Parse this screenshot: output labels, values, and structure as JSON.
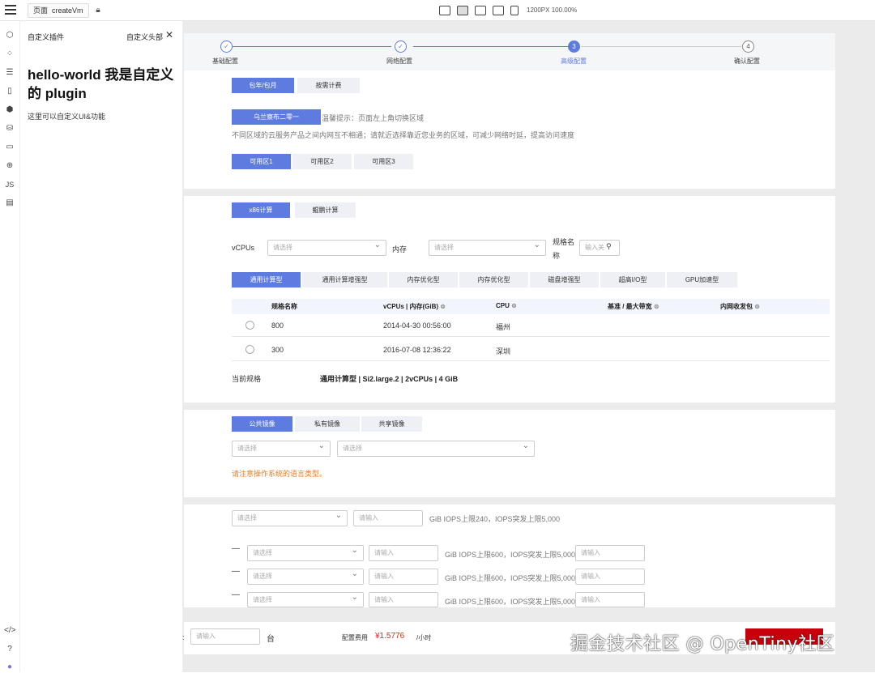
{
  "topbar": {
    "page_label": "页面",
    "page_name": "createVm",
    "zoom": "1200PX 100.00%"
  },
  "plugin": {
    "title": "自定义插件",
    "header_link": "自定义头部",
    "close": "✕",
    "hello": "hello-world 我是自定义的 plugin",
    "desc": "这里可以自定义UI&功能"
  },
  "steps": [
    {
      "num": "✓",
      "label": "基础配置"
    },
    {
      "num": "✓",
      "label": "网络配置"
    },
    {
      "num": "3",
      "label": "高级配置"
    },
    {
      "num": "4",
      "label": "确认配置"
    }
  ],
  "billing": {
    "monthly": "包年/包月",
    "on_demand": "按需计费"
  },
  "region": {
    "button": "乌兰察布二零一",
    "tip": "温馨提示：页面左上角切换区域",
    "note": "不同区域的云服务产品之间内网互不相通；请就近选择靠近您业务的区域，可减少网络时延，提高访问速度"
  },
  "zones": [
    "可用区1",
    "可用区2",
    "可用区3"
  ],
  "arch": [
    "x86计算",
    "鲲鹏计算"
  ],
  "filters": {
    "vcpus_label": "vCPUs",
    "vcpus_placeholder": "请选择",
    "mem_label": "内存",
    "mem_placeholder": "请选择",
    "spec_label": "规格名称",
    "spec_placeholder": "输入关"
  },
  "types": [
    "通用计算型",
    "通用计算增强型",
    "内存优化型",
    "内存优化型",
    "磁盘增强型",
    "超高I/O型",
    "GPU加速型"
  ],
  "table": {
    "headers": [
      "规格名称",
      "vCPUs | 内存(GiB)",
      "CPU",
      "基准 / 最大带宽",
      "内网收发包"
    ],
    "rows": [
      {
        "name": "800",
        "date": "2014-04-30 00:56:00",
        "city": "福州"
      },
      {
        "name": "300",
        "date": "2016-07-08 12:36:22",
        "city": "深圳"
      }
    ]
  },
  "current_spec": {
    "label": "当前规格",
    "value": "通用计算型 | Si2.large.2 | 2vCPUs | 4 GiB"
  },
  "images": {
    "tabs": [
      "公共镜像",
      "私有镜像",
      "共享镜像"
    ],
    "sel1": "请选择",
    "sel2": "请选择",
    "warning": "请注意操作系统的语言类型。"
  },
  "disk": {
    "sel": "请选择",
    "inp": "请输入",
    "sys_note": "GiB IOPS上限240，IOPS突发上限5,000",
    "data_note": "GiB IOPS上限600，IOPS突发上限5,000",
    "minus": "—"
  },
  "footer": {
    "colon": ":",
    "qty_placeholder": "请输入",
    "unit": "台",
    "fee_label": "配置费用",
    "price": "¥1.5776",
    "per": "/小时"
  },
  "watermark": "掘金技术社区 @ OpenTiny社区",
  "colors": {
    "primary": "#5e7ce0",
    "warn": "#e37d29",
    "price": "#e0271a",
    "buy": "#c7000b"
  }
}
